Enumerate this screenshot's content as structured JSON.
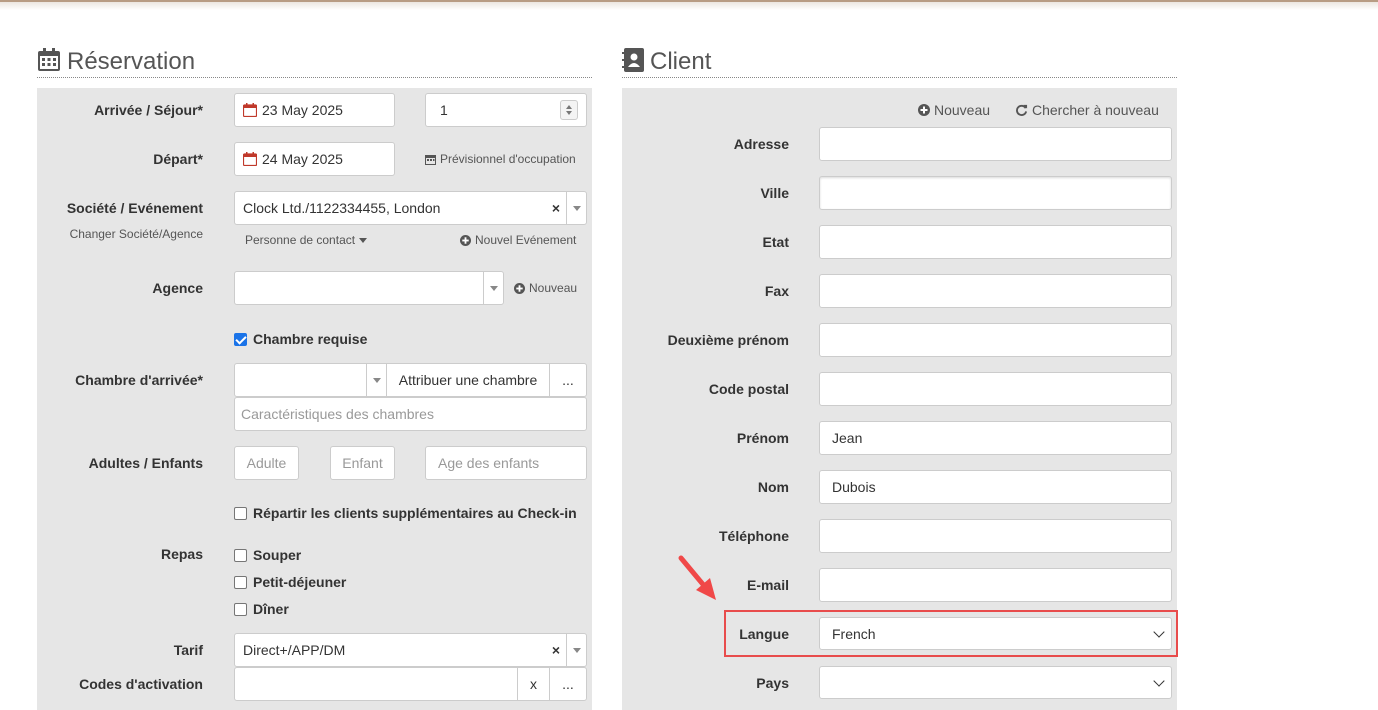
{
  "reservation": {
    "title": "Réservation",
    "arrival_label": "Arrivée / Séjour*",
    "arrival_date": "23 May 2025",
    "nights": "1",
    "departure_label": "Départ*",
    "departure_date": "24 May 2025",
    "forecast_link": "Prévisionnel d'occupation",
    "company_label": "Société / Evénement",
    "company_sub": "Changer Société/Agence",
    "company_value": "Clock Ltd./1122334455, London",
    "contact_person": "Personne de contact",
    "new_event": "Nouvel Evénement",
    "agency_label": "Agence",
    "agency_new": "Nouveau",
    "room_required": "Chambre requise",
    "arrival_room_label": "Chambre d'arrivée*",
    "assign_room": "Attribuer une chambre",
    "more": "...",
    "room_features_placeholder": "Caractéristiques des chambres",
    "adults_children_label": "Adultes / Enfants",
    "adult_placeholder": "Adulte",
    "child_placeholder": "Enfant",
    "child_ages_placeholder": "Age des enfants",
    "split_guests": "Répartir les clients supplémentaires au Check-in",
    "meals_label": "Repas",
    "meals": [
      "Souper",
      "Petit-déjeuner",
      "Dîner"
    ],
    "rate_label": "Tarif",
    "rate_value": "Direct+/APP/DM",
    "codes_label": "Codes d'activation",
    "codes_x": "x",
    "codes_more": "..."
  },
  "client": {
    "title": "Client",
    "new": "Nouveau",
    "search_again": "Chercher à nouveau",
    "fields": {
      "address": {
        "label": "Adresse",
        "value": ""
      },
      "city": {
        "label": "Ville",
        "value": ""
      },
      "state": {
        "label": "Etat",
        "value": ""
      },
      "fax": {
        "label": "Fax",
        "value": ""
      },
      "middle_name": {
        "label": "Deuxième prénom",
        "value": ""
      },
      "postal_code": {
        "label": "Code postal",
        "value": ""
      },
      "first_name": {
        "label": "Prénom",
        "value": "Jean"
      },
      "last_name": {
        "label": "Nom",
        "value": "Dubois"
      },
      "phone": {
        "label": "Téléphone",
        "value": ""
      },
      "email": {
        "label": "E-mail",
        "value": ""
      },
      "language": {
        "label": "Langue",
        "value": "French"
      },
      "country": {
        "label": "Pays",
        "value": ""
      }
    }
  },
  "colors": {
    "panel_bg": "#e6e6e6",
    "highlight": "#e84c4c",
    "accent": "#1a73e8",
    "calendar_icon": "#c0392b"
  }
}
